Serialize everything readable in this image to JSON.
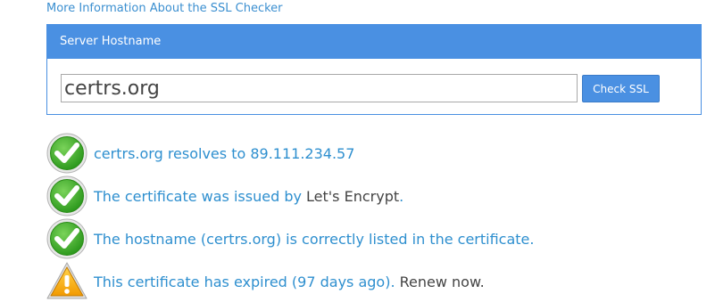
{
  "info_link": "More Information About the SSL Checker",
  "panel": {
    "header": "Server Hostname",
    "input_value": "certrs.org",
    "button_label": "Check SSL"
  },
  "results": [
    {
      "status": "ok",
      "icon": "green-checkmark-icon",
      "text": "certrs.org resolves to 89.111.234.57"
    },
    {
      "status": "ok",
      "icon": "green-checkmark-icon",
      "text_before": "The certificate was issued by ",
      "issuer": "Let's Encrypt",
      "text_after": "."
    },
    {
      "status": "ok",
      "icon": "green-checkmark-icon",
      "text": "The hostname (certrs.org) is correctly listed in the certificate."
    },
    {
      "status": "warning",
      "icon": "warning-triangle-icon",
      "text": "This certificate has expired (97 days ago).",
      "action": " Renew now."
    }
  ],
  "colors": {
    "accent": "#4a90e2",
    "link": "#2e8fcf",
    "ok": "#3fae2a",
    "warning": "#f7a600"
  }
}
